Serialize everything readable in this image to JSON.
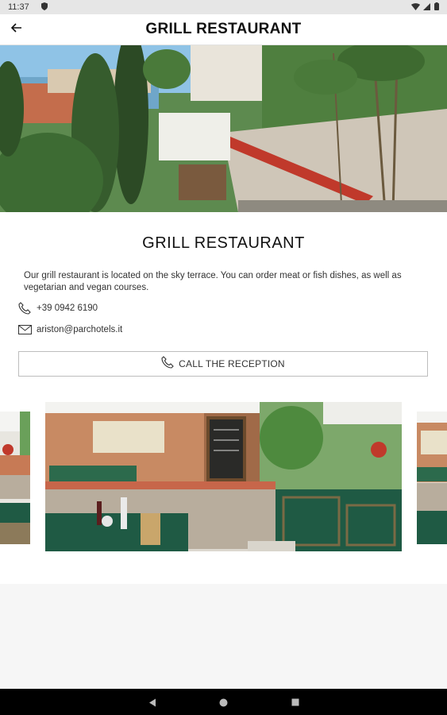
{
  "status_bar": {
    "time": "11:37",
    "notification_icon": "shield-notification-icon",
    "right_icons": [
      "wifi-icon",
      "signal-icon",
      "battery-icon"
    ]
  },
  "app_bar": {
    "title": "GRILL RESTAURANT",
    "back_icon": "arrow-left-icon"
  },
  "hero": {
    "image": "restaurant-terrace-photo"
  },
  "content": {
    "title": "GRILL RESTAURANT",
    "description": "Our grill restaurant is located on the sky terrace. You can order meat or fish dishes, as well as vegetarian and vegan courses.",
    "phone": "+39 0942 6190",
    "email": "ariston@parchotels.it",
    "call_button_label": "CALL THE RECEPTION"
  },
  "gallery": {
    "images": [
      "restaurant-interior-photo-prev",
      "restaurant-interior-photo",
      "restaurant-interior-photo-next"
    ]
  },
  "colors": {
    "app_bar_bg": "#ffffff",
    "page_bg": "#f6f6f6",
    "status_bar_bg": "#e6e6e6",
    "nav_bar_bg": "#000000",
    "table_green": "#1f5a44",
    "sky_blue": "#8fc3e6"
  },
  "nav_bar": {
    "buttons": [
      "back-triangle-icon",
      "home-circle-icon",
      "recents-square-icon"
    ]
  }
}
